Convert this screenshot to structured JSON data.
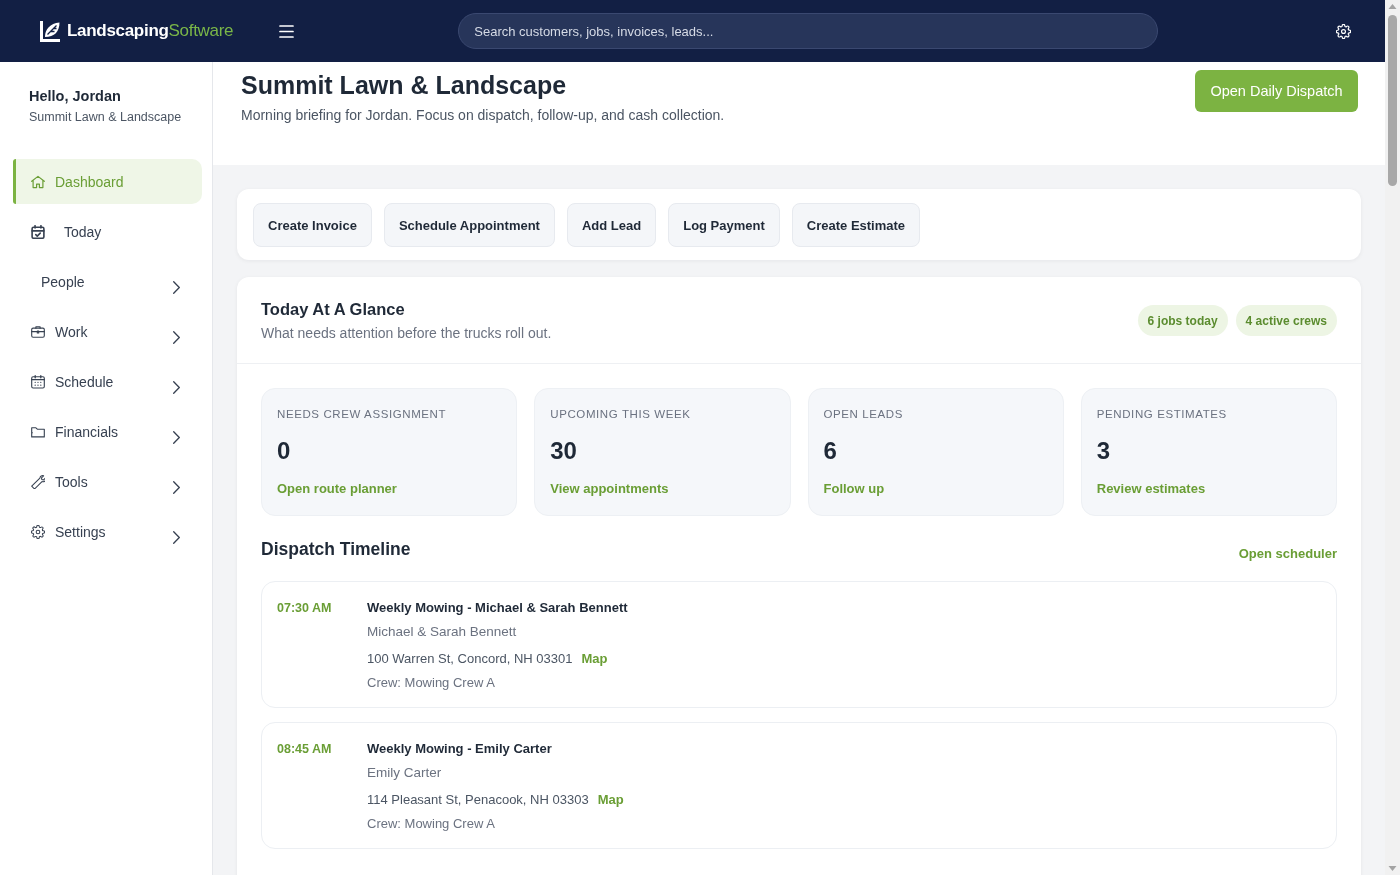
{
  "header": {
    "brand": "**Landscaping**Software",
    "search": {
      "placeholder": "Search customers, jobs, invoices, leads..."
    }
  },
  "sidebar": {
    "greeting": "Hello, Jordan",
    "company": "Summit Lawn & Landscape",
    "items": [
      {
        "label": "Dashboard",
        "selected": true,
        "submenu": false
      },
      {
        "label": "Today",
        "selected": false,
        "submenu": false
      },
      {
        "label": "People",
        "selected": false,
        "submenu": true
      },
      {
        "label": "Work",
        "selected": false,
        "submenu": true
      },
      {
        "label": "Schedule",
        "selected": false,
        "submenu": true
      },
      {
        "label": "Financials",
        "selected": false,
        "submenu": true
      },
      {
        "label": "Tools",
        "selected": false,
        "submenu": true
      },
      {
        "label": "Settings",
        "selected": false,
        "submenu": true
      }
    ]
  },
  "page": {
    "title": "Summit Lawn & Landscape",
    "subtitle": "Morning briefing for Jordan. Focus on dispatch, follow-up, and cash collection.",
    "primary_action": "Open Daily Dispatch"
  },
  "quick_actions": [
    "Create Invoice",
    "Schedule Appointment",
    "Add Lead",
    "Log Payment",
    "Create Estimate"
  ],
  "glance": {
    "title": "Today At A Glance",
    "subtitle": "What needs attention before the trucks roll out.",
    "badges": [
      "6 jobs today",
      "4 active crews"
    ],
    "stats": [
      {
        "label": "NEEDS CREW ASSIGNMENT",
        "value": "0",
        "link": "Open route planner"
      },
      {
        "label": "UPCOMING THIS WEEK",
        "value": "30",
        "link": "View appointments"
      },
      {
        "label": "OPEN LEADS",
        "value": "6",
        "link": "Follow up"
      },
      {
        "label": "PENDING ESTIMATES",
        "value": "3",
        "link": "Review estimates"
      }
    ]
  },
  "dispatch": {
    "title": "Dispatch Timeline",
    "link": "Open scheduler",
    "jobs": [
      {
        "time": "07:30 AM",
        "title": "Weekly Mowing - Michael & Sarah Bennett",
        "customer": "Michael & Sarah Bennett",
        "address": "100 Warren St, Concord, NH 03301",
        "map_link": "Map",
        "crew": "Crew: Mowing Crew A"
      },
      {
        "time": "08:45 AM",
        "title": "Weekly Mowing - Emily Carter",
        "customer": "Emily Carter",
        "address": "114 Pleasant St, Penacook, NH 03303",
        "map_link": "Map",
        "crew": "Crew: Mowing Crew A"
      }
    ]
  }
}
